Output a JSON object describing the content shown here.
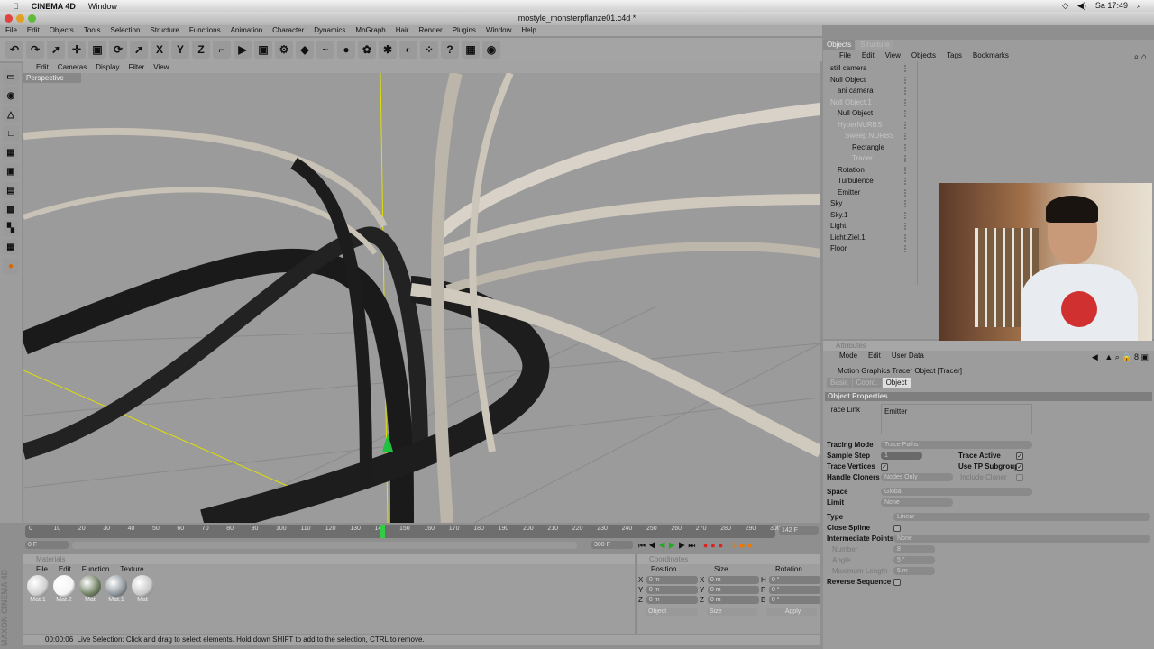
{
  "macbar": {
    "app": "CINEMA 4D",
    "menu": "Window",
    "clock": "Sa 17:49"
  },
  "window": {
    "title": "mostyle_monsterpflanze01.c4d *"
  },
  "menu": [
    "File",
    "Edit",
    "Objects",
    "Tools",
    "Selection",
    "Structure",
    "Functions",
    "Animation",
    "Character",
    "Dynamics",
    "MoGraph",
    "Hair",
    "Render",
    "Plugins",
    "Window",
    "Help"
  ],
  "toolbar_icons": [
    "undo-icon",
    "redo-icon",
    "select-icon",
    "move-icon",
    "scale-icon",
    "rotate-icon",
    "live-select-icon",
    "x-axis-icon",
    "y-axis-icon",
    "z-axis-icon",
    "coord-system-icon",
    "render-view-icon",
    "render-picture-viewer-icon",
    "render-settings-icon",
    "cube-icon",
    "spline-icon",
    "nurbs-icon",
    "array-icon",
    "deformer-icon",
    "scene-icon",
    "particle-icon",
    "help-icon",
    "layout-icon",
    "sphere-icon"
  ],
  "toolbar_glyphs": [
    "↶",
    "↷",
    "➚",
    "✛",
    "▣",
    "⟳",
    "➚",
    "X",
    "Y",
    "Z",
    "⌐",
    "▶",
    "▣",
    "⚙",
    "◆",
    "~",
    "●",
    "✿",
    "✱",
    "◐",
    "⁘",
    "?",
    "▦",
    "◉"
  ],
  "viewport": {
    "menu": [
      "Edit",
      "Cameras",
      "Display",
      "Filter",
      "View"
    ],
    "label": "Perspective"
  },
  "timeline": {
    "ticks": [
      "0",
      "10",
      "20",
      "30",
      "40",
      "50",
      "60",
      "70",
      "80",
      "90",
      "100",
      "110",
      "120",
      "130",
      "140",
      "150",
      "160",
      "170",
      "180",
      "190",
      "200",
      "210",
      "220",
      "230",
      "240",
      "250",
      "260",
      "270",
      "280",
      "290",
      "300"
    ],
    "current_frame": "142",
    "current_field": "142 F",
    "start": "0 F",
    "end": "300 F",
    "playhead": 0.473
  },
  "materials": {
    "title": "Materials",
    "menu": [
      "File",
      "Edit",
      "Function",
      "Texture"
    ],
    "items": [
      {
        "name": "Mat.1",
        "color": "#cfcfcf"
      },
      {
        "name": "Mat.2",
        "color": "#f4f4f4"
      },
      {
        "name": "Mat",
        "color": "#6f7f62"
      },
      {
        "name": "Mat.1",
        "color": "#8c949a"
      },
      {
        "name": "Mat",
        "color": "#c8c8c8"
      }
    ]
  },
  "coordinates": {
    "title": "Coordinates",
    "headers": [
      "Position",
      "Size",
      "Rotation"
    ],
    "rows": [
      {
        "a": "X",
        "p": "0 m",
        "b": "X",
        "s": "0 m",
        "c": "H",
        "r": "0 °"
      },
      {
        "a": "Y",
        "p": "0 m",
        "b": "Y",
        "s": "0 m",
        "c": "P",
        "r": "0 °"
      },
      {
        "a": "Z",
        "p": "0 m",
        "b": "Z",
        "s": "0 m",
        "c": "B",
        "r": "0 °"
      }
    ],
    "mode": "Object",
    "size_mode": "Size",
    "apply": "Apply"
  },
  "status": {
    "time": "00:00:06",
    "message": "Live Selection: Click and drag to select elements. Hold down SHIFT to add to the selection, CTRL to remove."
  },
  "brand": "MAXON CINEMA 4D",
  "objects": {
    "tabs": [
      "Objects",
      "Structure"
    ],
    "menu": [
      "File",
      "Edit",
      "View",
      "Objects",
      "Tags",
      "Bookmarks"
    ],
    "items": [
      {
        "name": "still camera",
        "indent": 1
      },
      {
        "name": "Null Object",
        "indent": 1
      },
      {
        "name": "ani camera",
        "indent": 2
      },
      {
        "name": "Null Object.1",
        "indent": 1,
        "dim": true
      },
      {
        "name": "Null Object",
        "indent": 2
      },
      {
        "name": "HyperNURBS",
        "indent": 2,
        "dim": true
      },
      {
        "name": "Sweep NURBS",
        "indent": 3,
        "dim": true
      },
      {
        "name": "Rectangle",
        "indent": 4
      },
      {
        "name": "Tracer",
        "indent": 4,
        "dim": true
      },
      {
        "name": "Rotation",
        "indent": 2
      },
      {
        "name": "Turbulence",
        "indent": 2
      },
      {
        "name": "Emitter",
        "indent": 2
      },
      {
        "name": "Sky",
        "indent": 1
      },
      {
        "name": "Sky.1",
        "indent": 1
      },
      {
        "name": "Light",
        "indent": 1
      },
      {
        "name": "Licht.Ziel.1",
        "indent": 1
      },
      {
        "name": "Floor",
        "indent": 1
      }
    ]
  },
  "attributes": {
    "title": "Attributes",
    "menu": [
      "Mode",
      "Edit",
      "User Data"
    ],
    "object": "Motion Graphics Tracer Object [Tracer]",
    "tabs": [
      "Basic",
      "Coord.",
      "Object"
    ],
    "section": "Object Properties",
    "trace_link_label": "Trace Link",
    "trace_link": "Emitter",
    "tracing_mode_label": "Tracing Mode",
    "tracing_mode": "Trace Paths",
    "sample_step_label": "Sample Step",
    "sample_step": "1",
    "trace_active_label": "Trace Active",
    "trace_vertices_label": "Trace Vertices",
    "use_tp_label": "Use TP Subgroups",
    "handle_cloners_label": "Handle Cloners",
    "handle_cloners": "Nodes Only",
    "include_cloner_label": "Include Cloner",
    "space_label": "Space",
    "space": "Global",
    "limit_label": "Limit",
    "limit": "None",
    "type_label": "Type",
    "type": "Linear",
    "close_spline_label": "Close Spline",
    "intermediate_label": "Intermediate Points",
    "intermediate": "None",
    "number_label": "Number",
    "number": "8",
    "angle_label": "Angle",
    "angle": "5 °",
    "maxlen_label": "Maximum Length",
    "maxlen": "5 m",
    "reverse_label": "Reverse Sequence"
  }
}
